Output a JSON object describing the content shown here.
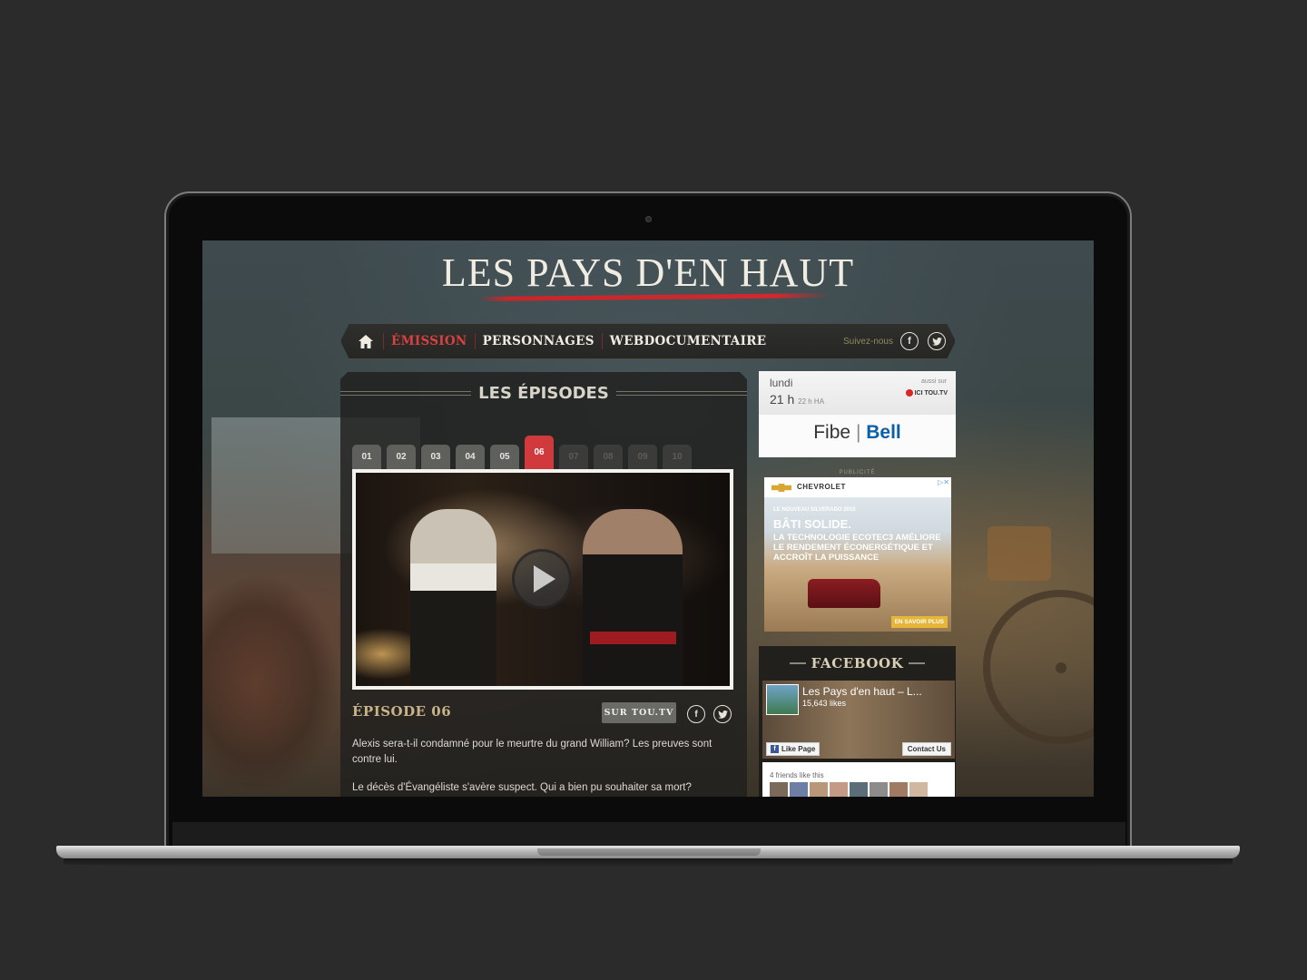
{
  "site": {
    "title": "LES PAYS D'EN HAUT"
  },
  "nav": {
    "home_icon": "home-icon",
    "items": [
      {
        "label": "ÉMISSION",
        "active": true
      },
      {
        "label": "PERSONNAGES",
        "active": false
      },
      {
        "label": "WEBDOCUMENTAIRE",
        "active": false
      }
    ],
    "follow_label": "Suivez-nous",
    "facebook_glyph": "f",
    "twitter_glyph": "t"
  },
  "episodes": {
    "heading": "LES ÉPISODES",
    "tabs": [
      {
        "label": "01",
        "state": "available"
      },
      {
        "label": "02",
        "state": "available"
      },
      {
        "label": "03",
        "state": "available"
      },
      {
        "label": "04",
        "state": "available"
      },
      {
        "label": "05",
        "state": "available"
      },
      {
        "label": "06",
        "state": "active"
      },
      {
        "label": "07",
        "state": "disabled"
      },
      {
        "label": "08",
        "state": "disabled"
      },
      {
        "label": "09",
        "state": "disabled"
      },
      {
        "label": "10",
        "state": "disabled"
      }
    ],
    "current": {
      "title": "ÉPISODE 06",
      "tou_button": "SUR TOU.TV",
      "desc1": "Alexis sera-t-il condamné pour le meurtre du grand William? Les preuves sont contre lui.",
      "desc2": "Le décès d'Évangéliste s'avère suspect. Qui a bien pu souhaiter sa mort?"
    }
  },
  "schedule": {
    "day": "lundi",
    "time": "21 h",
    "alt_time": "22 h HA",
    "also_label": "aussi sur",
    "also_brand": "ICI TOU.TV",
    "sponsor_left": "Fibe",
    "sponsor_sep": "|",
    "sponsor_right": "Bell"
  },
  "ad": {
    "label": "PUBLICITÉ",
    "brand": "CHEVROLET",
    "close": "▷✕",
    "small": "LE NOUVEAU SILVERADO 2015",
    "headline": "BÂTI SOLIDE.",
    "body": "LA TECHNOLOGIE ECOTEC3 AMÉLIORE LE RENDEMENT ÉCONERGÉTIQUE ET ACCROÎT LA PUISSANCE",
    "cta": "EN SAVOIR PLUS"
  },
  "facebook": {
    "heading": "FACEBOOK",
    "page_name": "Les Pays d'en haut – L...",
    "likes": "15,643 likes",
    "like_button": "Like Page",
    "contact_button": "Contact Us",
    "friends_text": "4 friends like this"
  },
  "colors": {
    "accent_red": "#d13a3c",
    "episode_gold": "#c9b48a",
    "bell_blue": "#0a5fa8"
  }
}
